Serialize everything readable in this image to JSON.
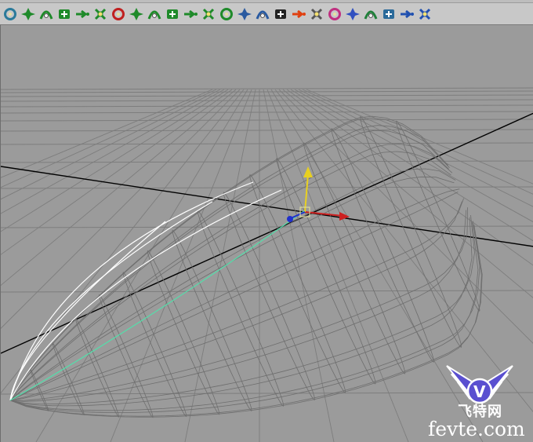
{
  "shelf": {
    "tools": [
      {
        "icon": "nurbs-circle-icon",
        "color": "#2a7a9a"
      },
      {
        "icon": "revolve-icon",
        "color": "#1f8a2a"
      },
      {
        "icon": "loft-icon",
        "color": "#1f8a2a"
      },
      {
        "icon": "planar-icon",
        "color": "#1f8a2a"
      },
      {
        "icon": "extrude-icon",
        "color": "#1f8a2a"
      },
      {
        "icon": "birail-icon",
        "color": "#1f8a2a"
      },
      {
        "icon": "boundary-icon",
        "color": "#c02020"
      },
      {
        "icon": "square-surface-icon",
        "color": "#1f8a2a"
      },
      {
        "icon": "bevel-icon",
        "color": "#1f8a2a"
      },
      {
        "icon": "project-curve-icon",
        "color": "#1f8a2a"
      },
      {
        "icon": "intersect-icon",
        "color": "#1f8a2a"
      },
      {
        "icon": "trim-icon",
        "color": "#1f8a2a"
      },
      {
        "icon": "untrim-icon",
        "color": "#1f8a2a"
      },
      {
        "icon": "attach-surfaces-icon",
        "color": "#2a5aa0"
      },
      {
        "icon": "detach-surfaces-icon",
        "color": "#2a5aa0"
      },
      {
        "icon": "align-surfaces-icon",
        "color": "#222222"
      },
      {
        "icon": "fire-effect-icon",
        "color": "#e04010"
      },
      {
        "icon": "smoke-effect-icon",
        "color": "#555555"
      },
      {
        "icon": "fireworks-effect-icon",
        "color": "#c03080"
      },
      {
        "icon": "lightning-effect-icon",
        "color": "#3050c0"
      },
      {
        "icon": "shatter-effect-icon",
        "color": "#20803a"
      },
      {
        "icon": "curve-flow-icon",
        "color": "#2a6a9a"
      },
      {
        "icon": "surface-flow-icon",
        "color": "#2050b0"
      },
      {
        "icon": "create-hair-icon",
        "color": "#2050b0"
      }
    ]
  },
  "viewport": {
    "background": "#9b9b9b",
    "grid_color": "#7d7d7d",
    "axis_color": "#000000",
    "wire_color": "#6e6e6e",
    "selected_curve_color": "#ffffff",
    "active_curve_color": "#55ddaa",
    "manipulator": {
      "x_axis_color": "#cc2020",
      "y_axis_color": "#e8d020",
      "z_axis_color": "#2030cc"
    }
  },
  "watermark": {
    "cn": "飞特网",
    "en": "fevte.com",
    "letter": "V"
  }
}
